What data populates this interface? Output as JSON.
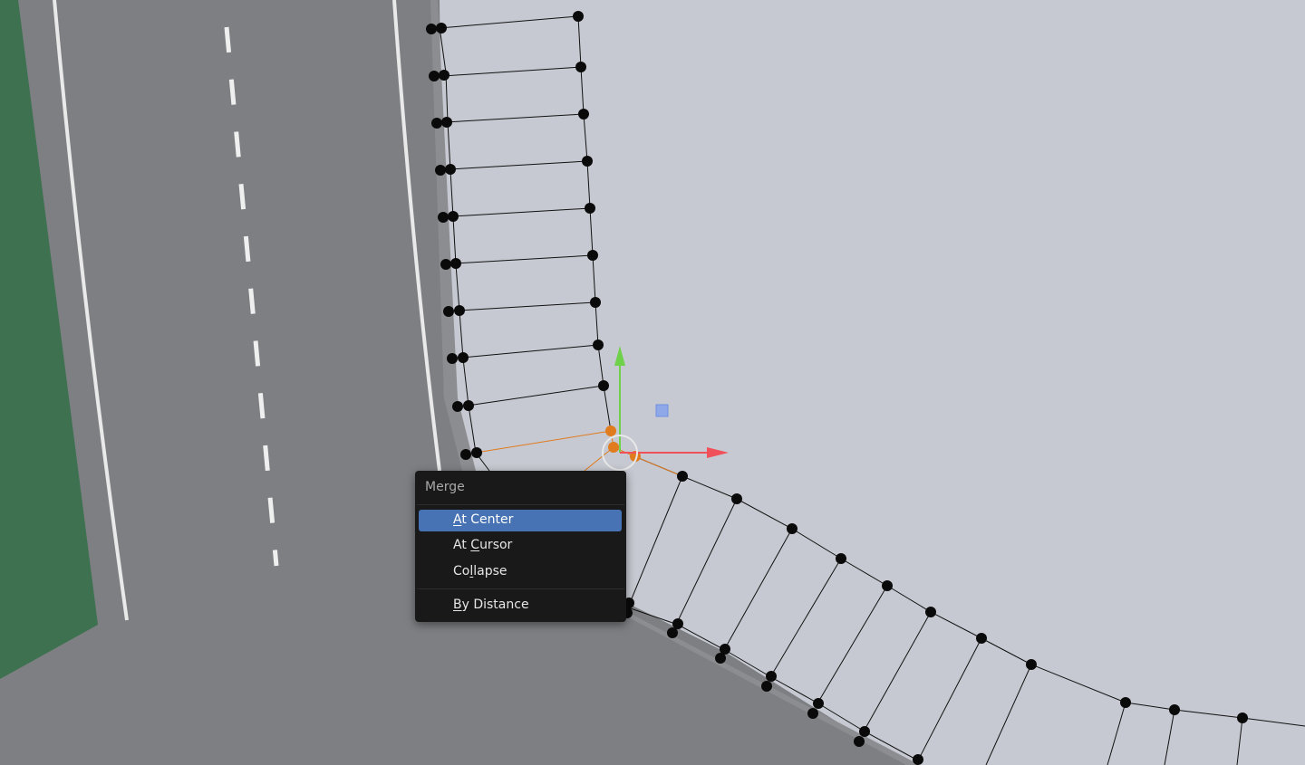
{
  "menu": {
    "title": "Merge",
    "items": [
      {
        "label": "At Center",
        "mnemonic": "A",
        "rest": "t Center",
        "active": true
      },
      {
        "label": "At Cursor",
        "mnemonic": "C",
        "pre": "At ",
        "rest": "ursor"
      },
      {
        "label": "Collapse",
        "mnemonic": "l",
        "pre": "Co",
        "rest": "lapse"
      },
      {
        "label": "By Distance",
        "mnemonic": "B",
        "rest": "y Distance"
      }
    ]
  },
  "colors": {
    "accent": "#4772b3",
    "menu_bg": "#191919",
    "background_plane": "#c6c9d1",
    "road": "#7d7f83",
    "grass": "#3d7150",
    "vertex": "#0a0a0a",
    "selected_vertex": "#e07b1e",
    "gizmo_x": "#f0505a",
    "gizmo_y": "#6fd14a"
  },
  "icons": [
    "3d-cursor-icon",
    "move-gizmo-x-arrow-icon",
    "move-gizmo-y-arrow-icon",
    "gizmo-plane-handle-icon"
  ]
}
